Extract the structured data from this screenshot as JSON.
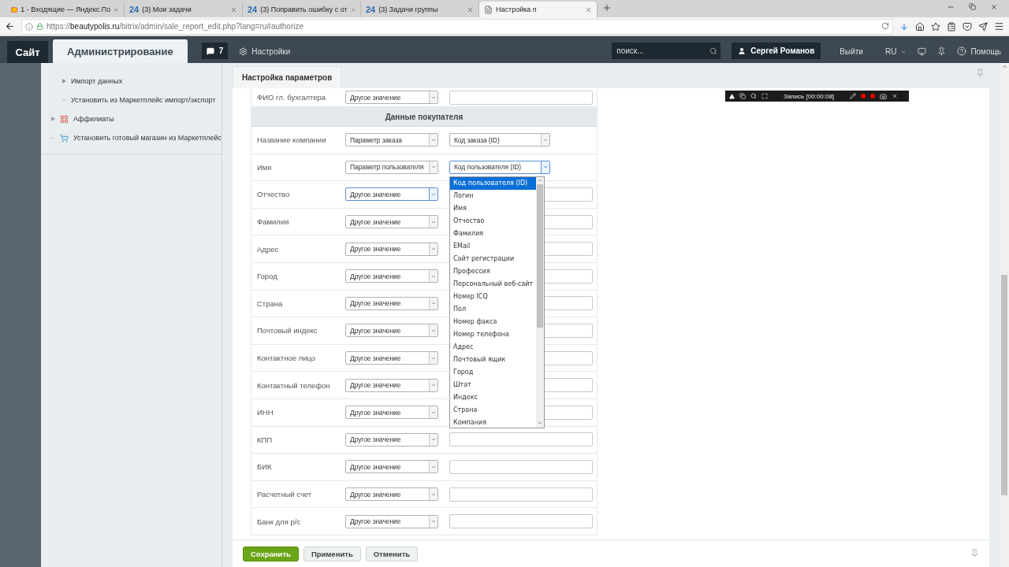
{
  "browser": {
    "tabs": [
      {
        "kind": "mail",
        "title": "1 - Входящие — Яндекс.По",
        "selected": false
      },
      {
        "kind": "portal",
        "badge": "24",
        "title": "(3) Мои задачи",
        "selected": false
      },
      {
        "kind": "portal",
        "badge": "24",
        "title": "(3) Поправить ошибку с от",
        "selected": false
      },
      {
        "kind": "portal",
        "badge": "24",
        "title": "(3) Задачи группы",
        "selected": false
      },
      {
        "kind": "page",
        "title": "Настройка п",
        "selected": true
      }
    ],
    "url": "https://**beautypolis.ru**/bitrix/admin/sale_report_edit.php?lang=ru#authorize"
  },
  "admin_bar": {
    "site_button": "Сайт",
    "tabs": [
      {
        "label": "Администрирование",
        "selected": true
      }
    ],
    "notifications": "7",
    "settings": "Настройки",
    "search": {
      "placeholder": "поиск..."
    },
    "user": "Сергей Романов",
    "logout": "Выйти",
    "language": "RU",
    "help": "Помощь"
  },
  "sidebar": {
    "sub_items": [
      {
        "kind": "expandable",
        "label": "Импорт данных"
      },
      {
        "kind": "leaf",
        "label": "Установить из Маркетплейс импорт/экспорт"
      }
    ],
    "items": [
      {
        "kind": "expandable",
        "label": "Аффилиаты"
      },
      {
        "kind": "leaf",
        "label": "Установить готовый магазин из Маркетплейс"
      }
    ]
  },
  "recorder": {
    "label": "Запись [00:00:08]"
  },
  "panel": {
    "tab": "Настройка параметров",
    "cut_row": {
      "label": "ФИО гл. бухгалтера",
      "source": "Другое значение"
    },
    "section": "Данные покупателя",
    "rows": [
      {
        "label": "Название компании",
        "source": {
          "value": "Параметр заказа",
          "focused": false
        },
        "field": {
          "kind": "select",
          "value": "Код заказа (ID)",
          "open": false
        }
      },
      {
        "label": "Имя",
        "source": {
          "value": "Параметр пользователя",
          "focused": false
        },
        "field": {
          "kind": "select",
          "value": "Код пользователя (ID)",
          "open": true,
          "options": [
            {
              "label": "Код пользователя (ID)",
              "selected": true
            },
            {
              "label": "Логин",
              "selected": false
            },
            {
              "label": "Имя",
              "selected": false
            },
            {
              "label": "Отчество",
              "selected": false
            },
            {
              "label": "Фамилия",
              "selected": false
            },
            {
              "label": "EMail",
              "selected": false
            },
            {
              "label": "Сайт регистрации",
              "selected": false
            },
            {
              "label": "Профессия",
              "selected": false
            },
            {
              "label": "Персональный веб-сайт",
              "selected": false
            },
            {
              "label": "Номер ICQ",
              "selected": false
            },
            {
              "label": "Пол",
              "selected": false
            },
            {
              "label": "Номер факса",
              "selected": false
            },
            {
              "label": "Номер телефона",
              "selected": false
            },
            {
              "label": "Адрес",
              "selected": false
            },
            {
              "label": "Почтовый ящик",
              "selected": false
            },
            {
              "label": "Город",
              "selected": false
            },
            {
              "label": "Штат",
              "selected": false
            },
            {
              "label": "Индекс",
              "selected": false
            },
            {
              "label": "Страна",
              "selected": false
            },
            {
              "label": "Компания",
              "selected": false
            }
          ]
        }
      },
      {
        "label": "Отчество",
        "source": {
          "value": "Другое значение",
          "focused": true
        },
        "field": {
          "kind": "input"
        }
      },
      {
        "label": "Фамилия",
        "source": {
          "value": "Другое значение",
          "focused": false
        },
        "field": {
          "kind": "input"
        }
      },
      {
        "label": "Адрес",
        "source": {
          "value": "Другое значение",
          "focused": false
        },
        "field": {
          "kind": "input"
        }
      },
      {
        "label": "Город",
        "source": {
          "value": "Другое значение",
          "focused": false
        },
        "field": {
          "kind": "input"
        }
      },
      {
        "label": "Страна",
        "source": {
          "value": "Другое значение",
          "focused": false
        },
        "field": {
          "kind": "input"
        }
      },
      {
        "label": "Почтовый индекс",
        "source": {
          "value": "Другое значение",
          "focused": false
        },
        "field": {
          "kind": "input"
        }
      },
      {
        "label": "Контактное лицо",
        "source": {
          "value": "Другое значение",
          "focused": false
        },
        "field": {
          "kind": "input"
        }
      },
      {
        "label": "Контактный телефон",
        "source": {
          "value": "Другое значение",
          "focused": false
        },
        "field": {
          "kind": "input"
        }
      },
      {
        "label": "ИНН",
        "source": {
          "value": "Другое значение",
          "focused": false
        },
        "field": {
          "kind": "input"
        }
      },
      {
        "label": "КПП",
        "source": {
          "value": "Другое значение",
          "focused": false
        },
        "field": {
          "kind": "input"
        }
      },
      {
        "label": "БИК",
        "source": {
          "value": "Другое значение",
          "focused": false
        },
        "field": {
          "kind": "input"
        }
      },
      {
        "label": "Расчетный счет",
        "source": {
          "value": "Другое значение",
          "focused": false
        },
        "field": {
          "kind": "input"
        }
      },
      {
        "label": "Банк для р/с",
        "source": {
          "value": "Другое значение",
          "focused": false
        },
        "field": {
          "kind": "input"
        }
      }
    ],
    "buttons": [
      {
        "kind": "primary",
        "label": "Сохранить"
      },
      {
        "kind": "default",
        "label": "Применить"
      },
      {
        "kind": "default",
        "label": "Отменить"
      }
    ]
  }
}
